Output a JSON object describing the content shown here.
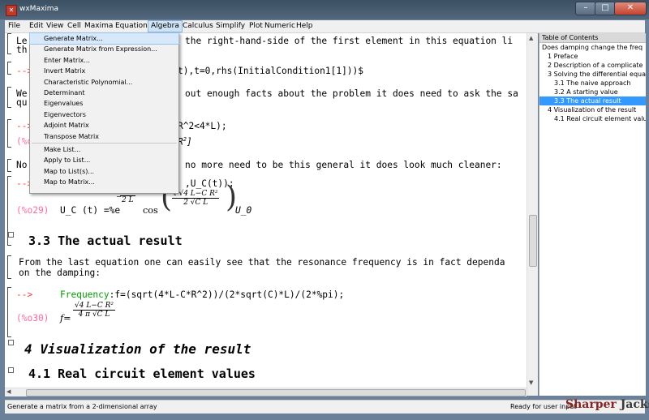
{
  "window": {
    "title": "wxMaxima"
  },
  "menubar": [
    "File",
    "Edit",
    "View",
    "Cell",
    "Maxima",
    "Equations",
    "Algebra",
    "Calculus",
    "Simplify",
    "Plot",
    "Numeric",
    "Help"
  ],
  "algebra_menu": {
    "group1": [
      "Generate Matrix...",
      "Generate Matrix from Expression...",
      "Enter Matrix...",
      "Invert Matrix",
      "Characteristic Polynomial...",
      "Determinant",
      "Eigenvalues",
      "Eigenvectors",
      "Adjoint Matrix",
      "Transpose Matrix"
    ],
    "group2": [
      "Make List...",
      "Apply to List...",
      "Map to List(s)...",
      "Map to Matrix..."
    ]
  },
  "doc": {
    "line1a": "Le",
    "line1b": "the right-hand-side of the first element in this equation li",
    "line2": "th",
    "prompt": "-->",
    "input1_tail": "t),t=0,rhs(InitialCondition1[1]))$",
    "text2a": "We",
    "text2b": "out enough facts about the problem it does need to ask the sa",
    "text2c": "qu",
    "input2_tail": "R^2<4*L);",
    "out2_label": "(%o",
    "out2_tail": "R",
    "out2_exp": "2",
    "out2_end": "]",
    "text3a": "No",
    "text3b": "no more need to be this general it does look much cleaner:",
    "input3_tail": ",U_C(t));",
    "out29_label": "(%o29)",
    "out29_lhs": "U_C (t) =%e",
    "out29_exp_num": "t R",
    "out29_exp_den": "2 L",
    "out29_cos": "cos",
    "out29_cos_num": "t √4 L−C R²",
    "out29_cos_den": "2 √C L",
    "out29_tail": "U_0",
    "section_heading": "3.3 The actual result",
    "para": "From the last equation one can easily see that the resonance frequency is in fact dependa",
    "para2": "on the damping:",
    "input4_name": "Frequency",
    "input4_rest": ":f=(sqrt(4*L-C*R^2))/(2*sqrt(C)*L)/(2*%pi);",
    "out30_label": "(%o30)",
    "out30_lhs": "f=",
    "out30_num": "√4 L−C R²",
    "out30_den": "4 π √C L",
    "chapter_heading": "4 Visualization of the result",
    "subsection_heading": "4.1 Real circuit element values"
  },
  "toc": {
    "header": "Table of Contents",
    "items": [
      "Does damping change the freq",
      "1 Preface",
      "2 Description of a complicate",
      "3 Solving the differential equa",
      "3.1 The naive approach",
      "3.2 A starting value",
      "3.3 The actual result",
      "4 Visualization of the result",
      "4.1 Real circuit element valu"
    ],
    "selected_index": 6
  },
  "status": {
    "left": "Generate a matrix from a 2-dimensional array",
    "right": "Ready for user input"
  },
  "watermark": "Sharper Jacks"
}
